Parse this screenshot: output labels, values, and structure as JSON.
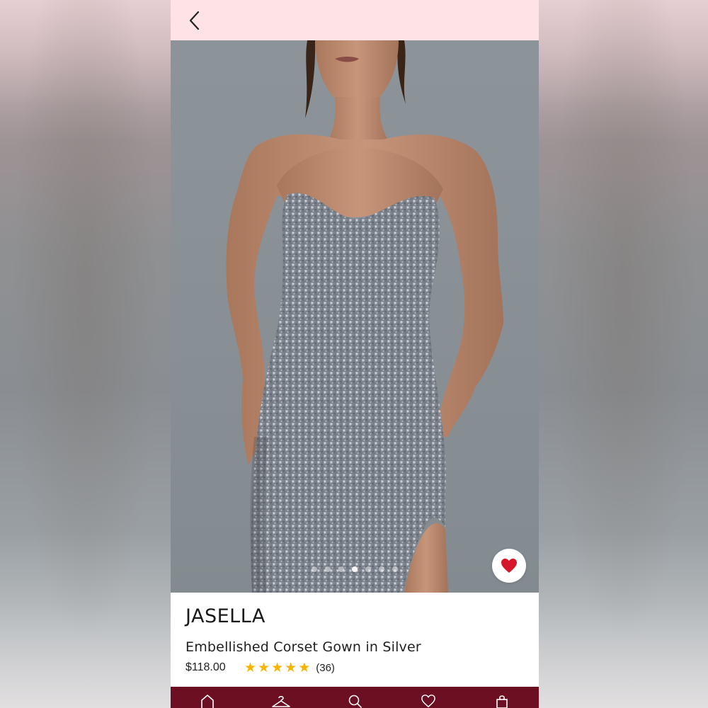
{
  "product": {
    "brand": "JASELLA",
    "name": "Embellished Corset Gown in Silver",
    "price": "$118.00",
    "rating": 5,
    "review_count": "(36)"
  },
  "gallery": {
    "image_count": 7,
    "active_index": 3,
    "favorited": true
  },
  "icons": {
    "back": "chevron-left-icon",
    "favorite": "heart-icon",
    "nav": [
      "home-icon",
      "hanger-icon",
      "search-icon",
      "heart-icon",
      "bag-icon"
    ]
  },
  "colors": {
    "top_bar": "#fde3e6",
    "nav_bar": "#6d0f22",
    "heart": "#d6162a",
    "star": "#f5b400"
  }
}
